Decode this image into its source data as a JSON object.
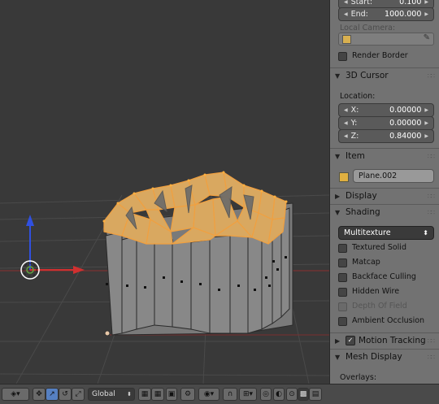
{
  "panel": {
    "start_label": "Start:",
    "start_value": "0.100",
    "end_label": "End:",
    "end_value": "1000.000",
    "local_camera_label": "Local Camera:",
    "render_border_label": "Render Border",
    "cursor_header": "3D Cursor",
    "location_label": "Location:",
    "x_label": "X:",
    "x_value": "0.00000",
    "y_label": "Y:",
    "y_value": "0.00000",
    "z_label": "Z:",
    "z_value": "0.84000",
    "item_header": "Item",
    "object_name": "Plane.002",
    "display_header": "Display",
    "shading_header": "Shading",
    "shading_mode": "Multitexture",
    "textured_solid": "Textured Solid",
    "matcap": "Matcap",
    "backface_culling": "Backface Culling",
    "hidden_wire": "Hidden Wire",
    "depth_of_field": "Depth Of Field",
    "ambient_occlusion": "Ambient Occlusion",
    "motion_tracking_header": "Motion Tracking",
    "mesh_display_header": "Mesh Display",
    "overlays_label": "Overlays:"
  },
  "toolbar": {
    "orientation": "Global"
  },
  "colors": {
    "selection_orange": "#f0a040",
    "mesh_grey": "#8a8a8a",
    "axis_red": "#d03030",
    "axis_green": "#60a040",
    "axis_blue": "#3050e0",
    "panel_bg": "#727272"
  }
}
